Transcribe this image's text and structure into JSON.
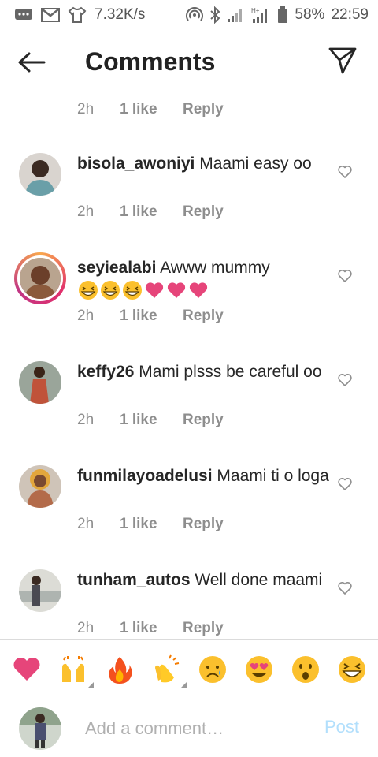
{
  "status_bar": {
    "speed": "7.32K/s",
    "battery": "58%",
    "time": "22:59",
    "left_icons": [
      "messages-icon",
      "gmail-icon",
      "shirt-icon"
    ],
    "right_icons": [
      "hotspot-icon",
      "bluetooth-icon",
      "signal-icon",
      "signal-h-icon",
      "battery-icon"
    ]
  },
  "header": {
    "title": "Comments",
    "back_icon": "arrow-left-icon",
    "send_icon": "send-icon"
  },
  "first_meta": {
    "time": "2h",
    "likes": "1 like",
    "reply": "Reply"
  },
  "comments": [
    {
      "username": "bisola_awoniyi",
      "text": "Maami easy oo",
      "time": "2h",
      "likes": "1 like",
      "reply": "Reply",
      "story_ring": false,
      "avatar_color": "#6a9fa8"
    },
    {
      "username": "seyiealabi",
      "text": "Awww mummy",
      "emojis": [
        "grinning-squint-emoji",
        "grinning-squint-emoji",
        "grinning-squint-emoji",
        "pink-heart-emoji",
        "pink-heart-emoji",
        "pink-heart-emoji"
      ],
      "time": "2h",
      "likes": "1 like",
      "reply": "Reply",
      "story_ring": true,
      "avatar_color": "#8b5a3c"
    },
    {
      "username": "keffy26",
      "text": "Mami plsss be careful oo",
      "time": "2h",
      "likes": "1 like",
      "reply": "Reply",
      "story_ring": false,
      "avatar_color": "#c0533a"
    },
    {
      "username": "funmilayoadelusi",
      "text": "Maami ti o loga",
      "time": "2h",
      "likes": "1 like",
      "reply": "Reply",
      "story_ring": false,
      "avatar_color": "#b36b4a"
    },
    {
      "username": "tunham_autos",
      "text": "Well done maami",
      "time": "2h",
      "likes": "1 like",
      "reply": "Reply",
      "story_ring": false,
      "avatar_color": "#8a9a8c"
    }
  ],
  "emoji_bar": [
    {
      "name": "red-heart-emoji",
      "has_variants": false
    },
    {
      "name": "raising-hands-emoji",
      "has_variants": true
    },
    {
      "name": "fire-emoji",
      "has_variants": false
    },
    {
      "name": "clapping-hands-emoji",
      "has_variants": true
    },
    {
      "name": "crying-face-emoji",
      "has_variants": false
    },
    {
      "name": "heart-eyes-emoji",
      "has_variants": false
    },
    {
      "name": "surprised-face-emoji",
      "has_variants": false
    },
    {
      "name": "grinning-squint-emoji",
      "has_variants": false
    }
  ],
  "input": {
    "placeholder": "Add a comment…",
    "value": "",
    "post_label": "Post"
  },
  "colors": {
    "text": "#262626",
    "meta": "#8e8e8e",
    "post_disabled": "#b2dffc",
    "heart": "#ed4c77"
  }
}
